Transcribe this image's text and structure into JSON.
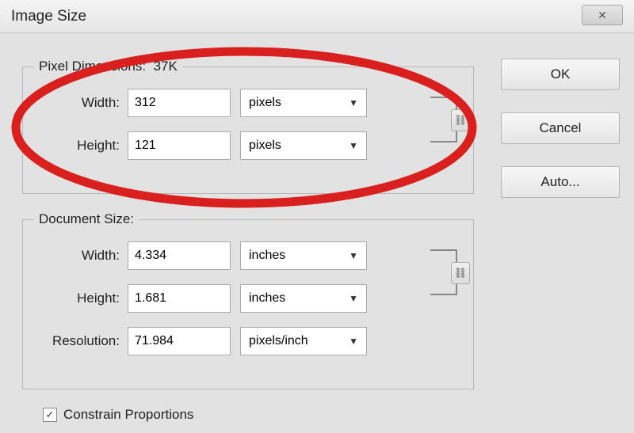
{
  "title": "Image Size",
  "pixel_dimensions": {
    "legend_prefix": "Pixel Dimensions:",
    "legend_value": "37K",
    "width_label": "Width:",
    "width_value": "312",
    "width_unit": "pixels",
    "height_label": "Height:",
    "height_value": "121",
    "height_unit": "pixels"
  },
  "document_size": {
    "legend": "Document Size:",
    "width_label": "Width:",
    "width_value": "4.334",
    "width_unit": "inches",
    "height_label": "Height:",
    "height_value": "1.681",
    "height_unit": "inches",
    "resolution_label": "Resolution:",
    "resolution_value": "71.984",
    "resolution_unit": "pixels/inch"
  },
  "constrain_label": "Constrain Proportions",
  "constrain_checked": "✓",
  "buttons": {
    "ok": "OK",
    "cancel": "Cancel",
    "auto": "Auto..."
  }
}
